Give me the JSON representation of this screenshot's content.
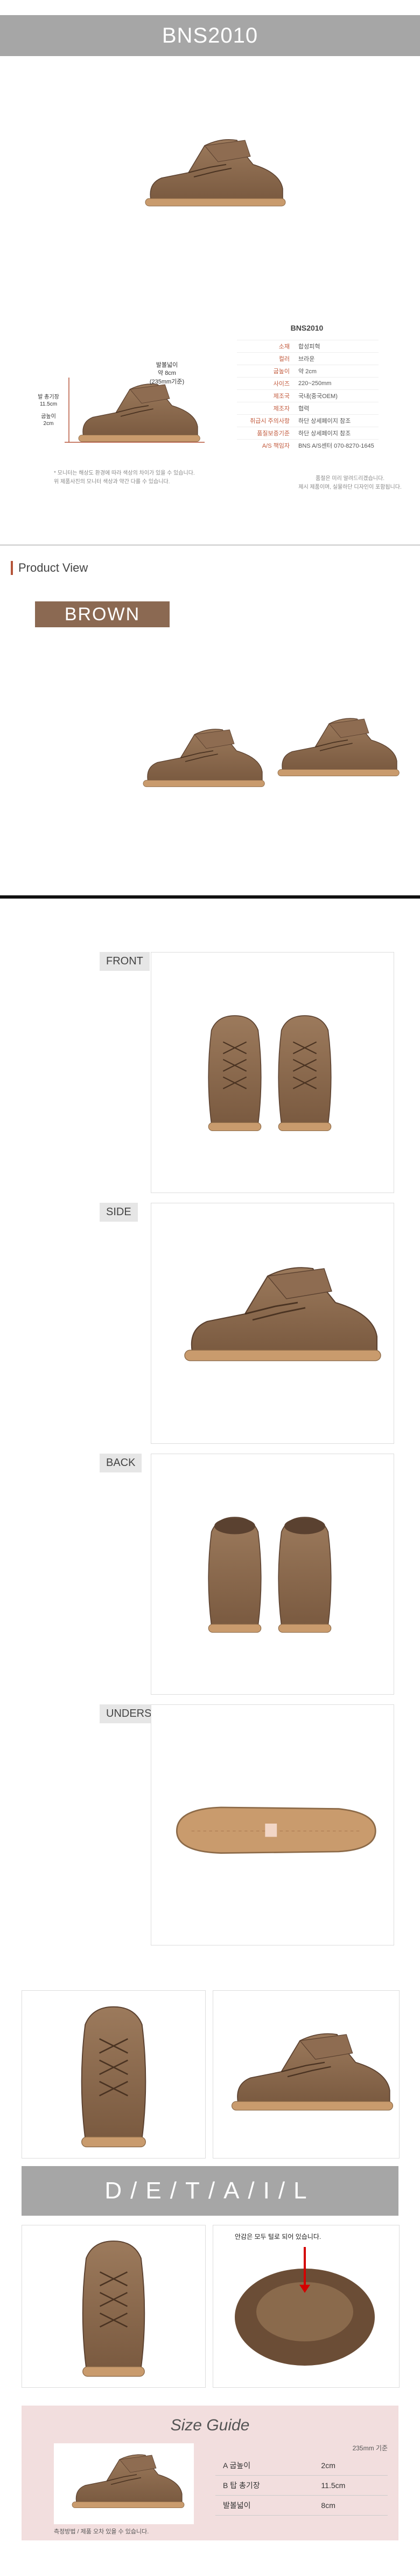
{
  "header": {
    "title": "BNS2010"
  },
  "measure_callout": {
    "heel_label": "발볼넓이",
    "heel_value": "약 8cm",
    "heel_basis": "(235mm기준)",
    "height_label": "발 총기장",
    "height_value": "11.5cm",
    "sole_label": "굽높이",
    "sole_value": "2cm"
  },
  "spec": {
    "title": "BNS2010",
    "rows": [
      {
        "k": "소재",
        "v": "합성피혁"
      },
      {
        "k": "컬러",
        "v": "브라운"
      },
      {
        "k": "굽높이",
        "v": "약 2cm"
      },
      {
        "k": "사이즈",
        "v": "220~250mm"
      },
      {
        "k": "제조국",
        "v": "국내(중국OEM)"
      },
      {
        "k": "제조자",
        "v": "협력"
      },
      {
        "k": "취급시 주의사항",
        "v": "하단 상세페이지 참조"
      },
      {
        "k": "품질보증기준",
        "v": "하단 상세페이지 참조"
      },
      {
        "k": "A/S 책임자",
        "v": "BNS A/S센터 070-8270-1645"
      }
    ]
  },
  "notes": {
    "left": [
      "* 모니터는 해상도 환경에 따라 색상의 차이가 있을 수 있습니다.",
      "위 제품사진의 모니터 색상과 약간 다를 수 있습니다."
    ],
    "right": [
      "품절은 미리 알려드리겠습니다.",
      "제시 제품이며, 실물하단 디자인이 포함됩니다."
    ]
  },
  "product_view": {
    "heading": "Product View",
    "color_tab": "BROWN"
  },
  "views": [
    {
      "label": "FRONT"
    },
    {
      "label": "SIDE"
    },
    {
      "label": "BACK"
    },
    {
      "label": "UNDERSIDE"
    }
  ],
  "detail": {
    "bar_text": "D/E/T/A/I/L",
    "callout": "안감은 모두 털로 되어 있습니다."
  },
  "size_guide": {
    "title": "Size Guide",
    "basis": "235mm 기준",
    "rows": [
      {
        "k": "A 굽높이",
        "v": "2cm"
      },
      {
        "k": "B 탑 총기장",
        "v": "11.5cm"
      },
      {
        "k": "발볼넓이",
        "v": "8cm"
      }
    ],
    "caption": "측정방법 / 제품 오차 있을 수 있습니다."
  },
  "colors": {
    "title_bar": "#a6a6a6",
    "brand_accent": "#b5553a",
    "leather": "#8b6952",
    "size_guide_bg": "#f2dede"
  }
}
